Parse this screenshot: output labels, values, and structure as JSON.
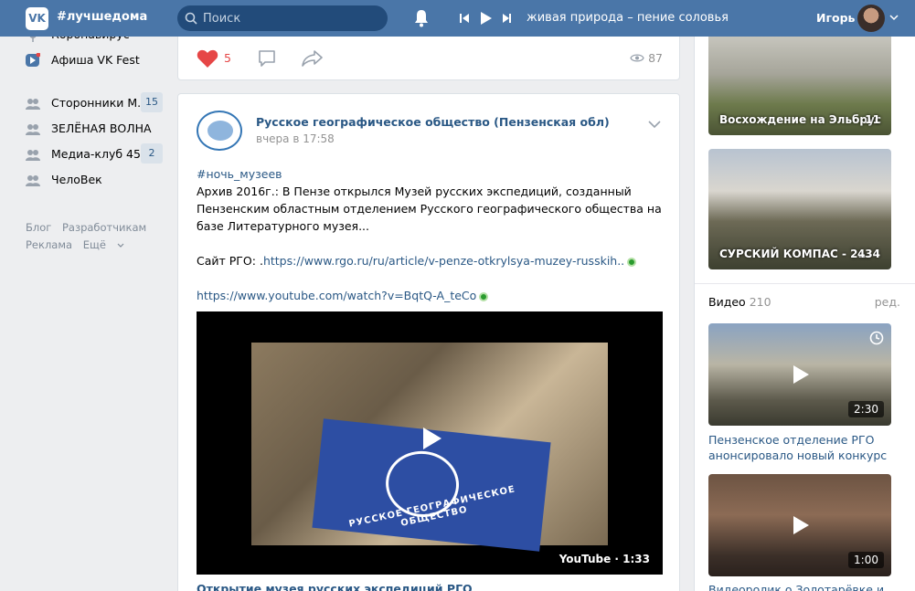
{
  "header": {
    "logo_text": "VK",
    "brand": "#лучшедома",
    "search_placeholder": "Поиск",
    "track": "живая природа – пение соловья",
    "user_name": "Игорь"
  },
  "sidebar": {
    "items": [
      {
        "label": "Коронавирус",
        "icon": "virus-icon"
      },
      {
        "label": "Афиша VK Fest",
        "icon": "vkfest-icon"
      },
      {
        "label": "Сторонники М...",
        "badge": "15",
        "icon": "community-icon"
      },
      {
        "label": "ЗЕЛЁНАЯ ВОЛНА",
        "icon": "community-icon"
      },
      {
        "label": "Медиа-клуб 45 ...",
        "badge": "2",
        "icon": "community-icon"
      },
      {
        "label": "ЧелоВек",
        "icon": "community-icon"
      }
    ],
    "footer": {
      "blog": "Блог",
      "developers": "Разработчикам",
      "ads": "Реклама",
      "more": "Ещё"
    }
  },
  "feed": {
    "prev_post": {
      "likes": "5",
      "views": "87"
    },
    "post": {
      "group_name": "Русское географическое общество (Пензенская обл)",
      "time": "вчера в 17:58",
      "hashtag": "#ночь_музеев",
      "text": "Архив 2016г.: В Пензе открылся Музей русских экспедиций, созданный Пензенским областным отделением Русского географического общества на базе Литературного музея...",
      "site_label": "Сайт РГО: .",
      "site_link": "https://www.rgo.ru/ru/article/v-penze-otkrylsya-muzey-russkih..",
      "youtube_link": "https://www.youtube.com/watch?v=BqtQ-A_teCo",
      "video_label": "YouTube · 1:33",
      "flag_text": "РУССКОЕ ГЕОГРАФИЧЕСКОЕ ОБЩЕСТВО",
      "video_title": "Открытие музея русских экспедиций РГО"
    }
  },
  "right": {
    "albums": [
      {
        "title": "Восхождение на Эльбрус",
        "count": "11"
      },
      {
        "title": "СУРСКИЙ КОМПАС - 2...",
        "count": "434"
      }
    ],
    "videos_header": "Видео",
    "videos_count": "210",
    "videos_edit": "ред.",
    "videos": [
      {
        "title": "Пензенское отделение РГО анонсировало новый конкурс",
        "duration": "2:30"
      },
      {
        "title": "Видеоролик о Золотарёвке и",
        "duration": "1:00"
      }
    ]
  },
  "colors": {
    "header_bg": "#4a76a8",
    "link": "#2a5885",
    "like_red": "#e64646"
  }
}
